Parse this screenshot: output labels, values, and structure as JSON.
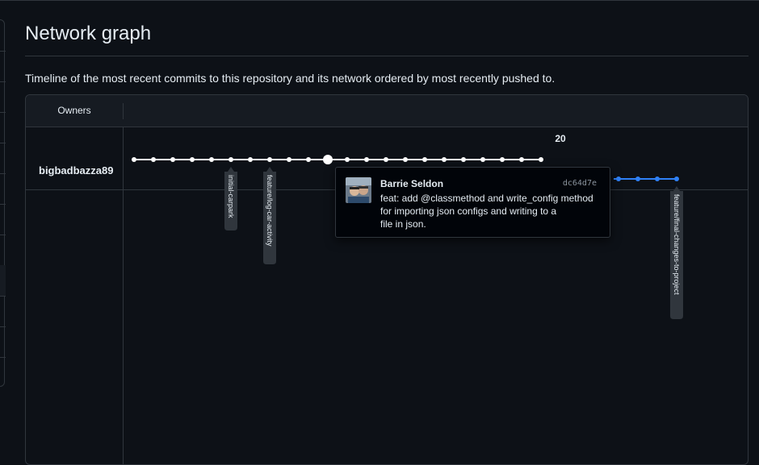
{
  "page": {
    "title": "Network graph",
    "description": "Timeline of the most recent commits to this repository and its network ordered by most recently pushed to."
  },
  "graph": {
    "owners_header": "Owners",
    "owner": "bigbadbazza89",
    "date_label": "20",
    "branches": [
      {
        "name": "initial-carpark"
      },
      {
        "name": "feature/log-car-activity"
      },
      {
        "name": "feature/final-changes-to-project"
      }
    ],
    "colors": {
      "main_line": "#ffffff",
      "branch_line": "#2f81f7",
      "label_bg": "#30363d"
    }
  },
  "tooltip": {
    "author": "Barrie Seldon",
    "sha": "dc64d7e",
    "message_lines": [
      "feat: add @classmethod and write_config method",
      "for importing json configs and writing to a",
      "file in json."
    ]
  },
  "icons": {
    "avatar": "user-avatar-photo"
  }
}
